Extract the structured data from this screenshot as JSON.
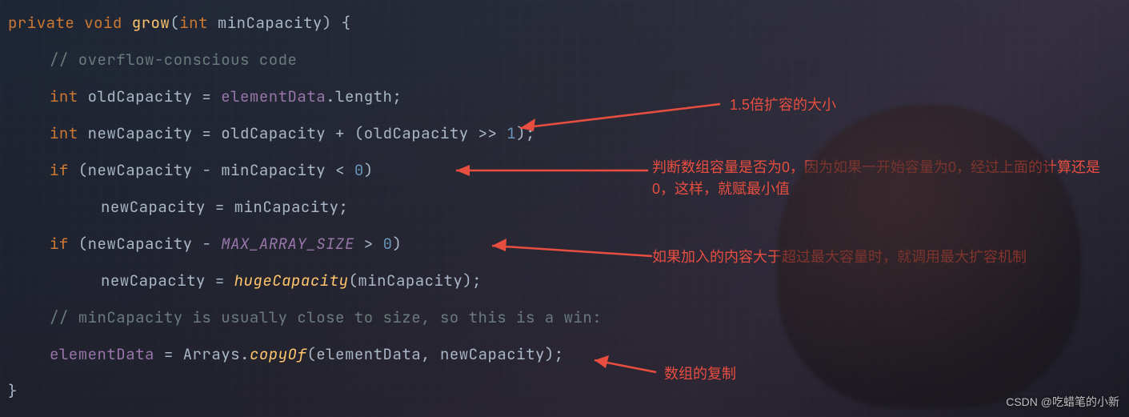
{
  "code": {
    "l1": {
      "kw_private": "private",
      "kw_void": "void",
      "fn": "grow",
      "paren_o": "(",
      "type_int": "int",
      "param": "minCapacity",
      "paren_c": ")",
      "brace": "{"
    },
    "l2": {
      "comment": "// overflow-conscious code"
    },
    "l3": {
      "type": "int",
      "lhs": "oldCapacity",
      "eq": "=",
      "field": "elementData",
      "dot": ".",
      "prop": "length",
      "semi": ";"
    },
    "l4": {
      "type": "int",
      "lhs": "newCapacity",
      "eq": "=",
      "a": "oldCapacity",
      "plus": "+",
      "po": "(",
      "b": "oldCapacity",
      "shift": ">>",
      "one": "1",
      "pc": ")",
      "semi": ";"
    },
    "l5": {
      "kw_if": "if",
      "po": "(",
      "a": "newCapacity",
      "minus": "-",
      "b": "minCapacity",
      "lt": "<",
      "zero": "0",
      "pc": ")"
    },
    "l6": {
      "lhs": "newCapacity",
      "eq": "=",
      "rhs": "minCapacity",
      "semi": ";"
    },
    "l7": {
      "kw_if": "if",
      "po": "(",
      "a": "newCapacity",
      "minus": "-",
      "const": "MAX_ARRAY_SIZE",
      "gt": ">",
      "zero": "0",
      "pc": ")"
    },
    "l8": {
      "lhs": "newCapacity",
      "eq": "=",
      "fn": "hugeCapacity",
      "po": "(",
      "arg": "minCapacity",
      "pc": ")",
      "semi": ";"
    },
    "l9": {
      "comment": "// minCapacity is usually close to size, so this is a win:"
    },
    "l10": {
      "lhs": "elementData",
      "eq": "=",
      "cls": "Arrays",
      "dot": ".",
      "fn": "copyOf",
      "po": "(",
      "a1": "elementData",
      "comma": ",",
      "a2": "newCapacity",
      "pc": ")",
      "semi": ";"
    },
    "l11": {
      "brace": "}"
    }
  },
  "annotations": {
    "a1": "1.5倍扩容的大小",
    "a2": "判断数组容量是否为0，因为如果一开始容量为0，经过上面的计算还是0，这样，就赋最小值",
    "a3": "如果加入的内容大于超过最大容量时，就调用最大扩容机制",
    "a4": "数组的复制"
  },
  "watermark": "CSDN @吃蜡笔的小新"
}
